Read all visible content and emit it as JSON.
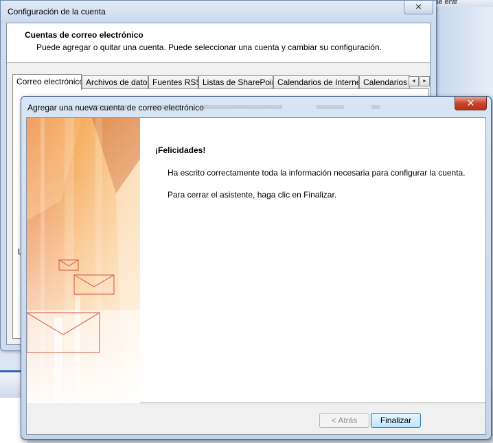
{
  "background": {
    "right_text": "bandeja de entr"
  },
  "back_dialog": {
    "title": "Configuración de la cuenta",
    "close_symbol": "✕",
    "header_title": "Cuentas de correo electrónico",
    "header_subtitle": "Puede agregar o quitar una cuenta. Puede seleccionar una cuenta y cambiar su configuración.",
    "tabs": [
      {
        "label": "Correo electrónico"
      },
      {
        "label": "Archivos de datos"
      },
      {
        "label": "Fuentes RSS"
      },
      {
        "label": "Listas de SharePoint"
      },
      {
        "label": "Calendarios de Internet"
      },
      {
        "label": "Calendarios p"
      }
    ],
    "tab_scroll_left": "◄",
    "tab_scroll_right": "►",
    "left_letter": "L"
  },
  "front_dialog": {
    "title": "Agregar una nueva cuenta de correo electrónico",
    "close_symbol": "✕",
    "heading": "¡Felicidades!",
    "message_1": "Ha escrito correctamente toda la información necesaria para configurar la cuenta.",
    "message_2": "Para cerrar el asistente, haga clic en Finalizar.",
    "back_button": "< Atrás",
    "finish_button": "Finalizar"
  },
  "colors": {
    "art_orange": "#f08a2a",
    "art_light": "#fde3c2",
    "envelope_red": "#d8543d"
  }
}
